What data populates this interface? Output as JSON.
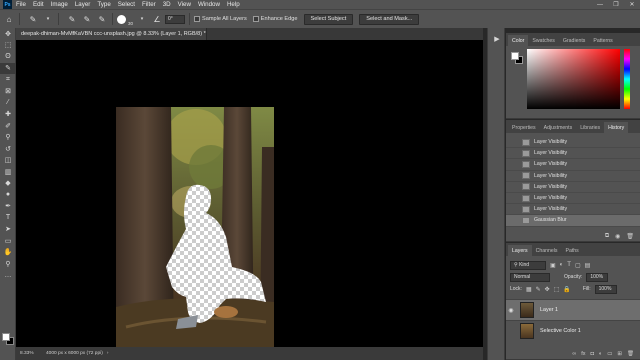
{
  "menu": {
    "logo": "Ps",
    "items": [
      "File",
      "Edit",
      "Image",
      "Layer",
      "Type",
      "Select",
      "Filter",
      "3D",
      "View",
      "Window",
      "Help"
    ],
    "window_controls": [
      "—",
      "❐",
      "✕"
    ]
  },
  "options": {
    "brush_size": "30",
    "angle": "0°",
    "sample_all_layers": "Sample All Layers",
    "enhance_edge": "Enhance Edge",
    "select_subject": "Select Subject",
    "select_and_mask": "Select and Mask..."
  },
  "document": {
    "tab_title": "deepak-dhiman-MvMfKaVBN ccc-unsplash.jpg @ 8.33% (Layer 1, RGB/8) *",
    "zoom": "8.33%",
    "doc_size": "4000 px x 6000 px (72 ppi)"
  },
  "color_panel": {
    "tabs": [
      "Color",
      "Swatches",
      "Gradients",
      "Patterns"
    ],
    "active_tab": "Color",
    "foreground": "#ffffff",
    "background": "#000000"
  },
  "history_panel": {
    "tabs": [
      "Properties",
      "Adjustments",
      "Libraries",
      "History"
    ],
    "active_tab": "History",
    "items": [
      "Layer Visibility",
      "Layer Visibility",
      "Layer Visibility",
      "Layer Visibility",
      "Layer Visibility",
      "Layer Visibility",
      "Layer Visibility",
      "Gaussian Blur"
    ]
  },
  "layers_panel": {
    "tabs": [
      "Layers",
      "Channels",
      "Paths"
    ],
    "active_tab": "Layers",
    "kind": "Kind",
    "blend_mode": "Normal",
    "opacity_label": "Opacity:",
    "opacity_value": "100%",
    "lock_label": "Lock:",
    "fill_label": "Fill:",
    "fill_value": "100%",
    "layers": [
      {
        "name": "Layer 1",
        "selected": true
      },
      {
        "name": "Selective Color 1",
        "selected": false
      }
    ]
  },
  "accent_colors": {
    "ui_dark": "#535353",
    "canvas": "#000000",
    "selected_row": "#6e6e6e"
  }
}
